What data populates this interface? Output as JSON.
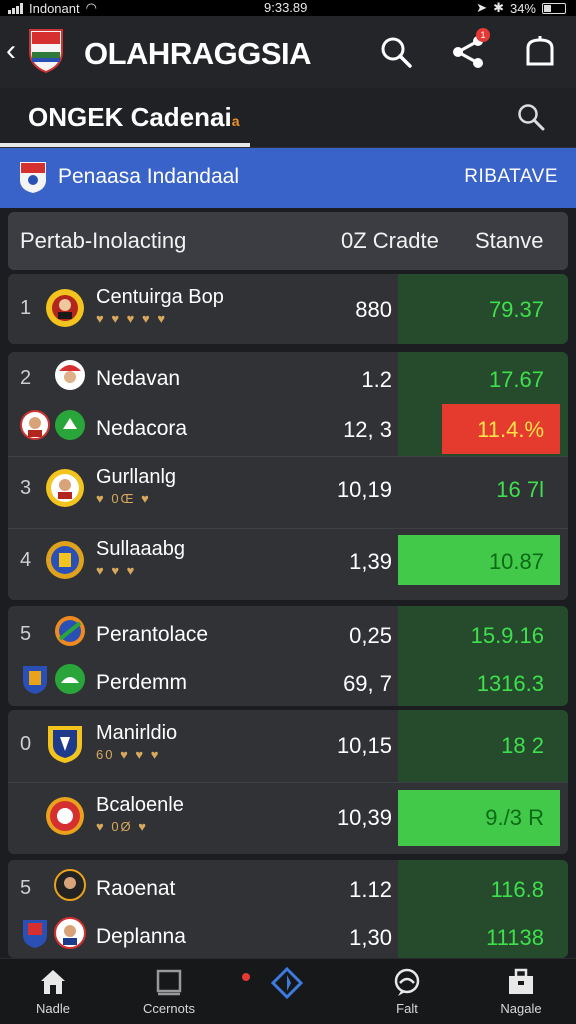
{
  "status_bar": {
    "carrier": "Indonant",
    "time": "9:33.89",
    "battery": "34%"
  },
  "app_bar": {
    "title": "OLAHRAGGSIA",
    "notification_count": "1"
  },
  "sub_bar": {
    "tab_label": "ONGEK  Cadenai",
    "tab_marker": "a"
  },
  "league": {
    "name": "Penaasa Indandaal",
    "link": "RIBATAVE"
  },
  "table": {
    "headers": {
      "team": "Pertab-Inolacting",
      "grade": "0Z Cradte",
      "status": "Stanve"
    },
    "rows": [
      {
        "rank": "1",
        "team": "Centuirga Bop",
        "form": "♥ ♥ ♥ ♥ ♥",
        "value": "880",
        "rate": "79.37"
      },
      {
        "rank": "2",
        "team": "Nedavan",
        "value": "1.2",
        "rate": "17.67"
      },
      {
        "rank": "",
        "team": "Nedacora",
        "value": "12, 3",
        "rate": "11.4.%"
      },
      {
        "rank": "3",
        "team": "Gurllanlg",
        "form": "♥ 0Œ ♥",
        "value": "10,19",
        "rate": "16  7l"
      },
      {
        "rank": "4",
        "team": "Sullaaabg",
        "form": "♥ ♥ ♥",
        "value": "1,39",
        "rate": "10.87"
      },
      {
        "rank": "5",
        "team": "Perantolace",
        "value": "0,25",
        "rate": "15.9.16"
      },
      {
        "rank": "",
        "team": "Perdemm",
        "value": "69, 7",
        "rate": "1316.3"
      },
      {
        "rank": "0",
        "team": "Manirldio",
        "form": "60 ♥ ♥ ♥",
        "value": "10,15",
        "rate": "18  2"
      },
      {
        "rank": "",
        "team": "Bcaloenle",
        "form": "♥ 0Ø ♥",
        "value": "10,39",
        "rate": "9./3 R"
      },
      {
        "rank": "5",
        "team": "Raoenat",
        "value": "1.12",
        "rate": "116.8"
      },
      {
        "rank": "",
        "team": "Deplanna",
        "value": "1,30",
        "rate": "11138"
      }
    ]
  },
  "bottom_nav": [
    {
      "label": "Nadle",
      "icon": "home-icon"
    },
    {
      "label": "Ccernots",
      "icon": "scoreboard-icon"
    },
    {
      "label": "",
      "icon": "compass-icon"
    },
    {
      "label": "Falt",
      "icon": "chat-icon"
    },
    {
      "label": "Nagale",
      "icon": "store-icon"
    }
  ],
  "colors": {
    "accent_blue": "#3a63c9",
    "positive_green": "#42c94a",
    "negative_red": "#e53a2e",
    "rate_text_green": "#3ee04d"
  }
}
